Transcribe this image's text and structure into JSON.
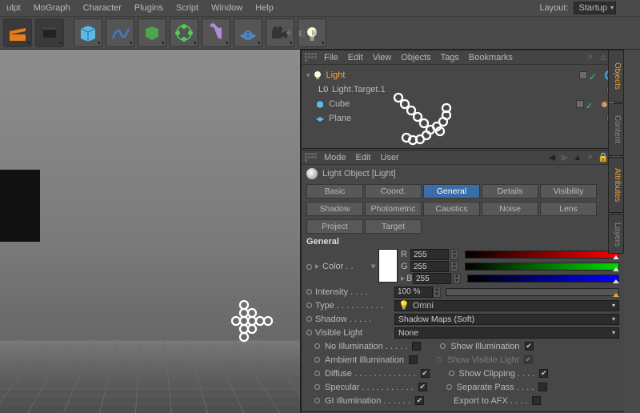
{
  "menu": {
    "items": [
      "ulpt",
      "MoGraph",
      "Character",
      "Plugins",
      "Script",
      "Window",
      "Help"
    ]
  },
  "layout": {
    "label": "Layout:",
    "value": "Startup"
  },
  "objects_panel": {
    "menus": [
      "File",
      "Edit",
      "View",
      "Objects",
      "Tags",
      "Bookmarks"
    ],
    "items": [
      {
        "name": "Light",
        "type": "light",
        "selected": true,
        "tag": "target"
      },
      {
        "name": "Light.Target.1",
        "type": "null",
        "indent": true
      },
      {
        "name": "Cube",
        "type": "cube",
        "active": true
      },
      {
        "name": "Plane",
        "type": "plane"
      }
    ]
  },
  "attributes_panel": {
    "menus": [
      "Mode",
      "Edit",
      "User"
    ],
    "title": "Light Object [Light]",
    "tabs_row1": [
      "Basic",
      "Coord.",
      "General",
      "Details",
      "Visibility"
    ],
    "tabs_row2": [
      "Shadow",
      "Photometric",
      "Caustics",
      "Noise",
      "Lens"
    ],
    "tabs_row3": [
      "Project",
      "Target"
    ],
    "active_tab": "General",
    "section": "General",
    "color": {
      "label": "Color . .",
      "r": "255",
      "g": "255",
      "b": "255",
      "labels": {
        "r": "R",
        "g": "G",
        "b": "B"
      }
    },
    "intensity": {
      "label": "Intensity . . . .",
      "value": "100 %"
    },
    "type": {
      "label": "Type . . . . . . . . . .",
      "value": "Omni"
    },
    "shadow": {
      "label": "Shadow . . . . .",
      "value": "Shadow Maps (Soft)"
    },
    "visible_light": {
      "label": "Visible Light",
      "value": "None"
    },
    "checks": {
      "no_illum": {
        "label": "No Illumination . . . . .",
        "value": false
      },
      "show_illum": {
        "label": "Show Illumination",
        "value": true
      },
      "ambient": {
        "label": "Ambient Illumination",
        "value": false
      },
      "show_vis": {
        "label": "Show Visible Light",
        "value": true,
        "disabled": true
      },
      "diffuse": {
        "label": "Diffuse . . . . . . . . . . . . .",
        "value": true
      },
      "show_clip": {
        "label": "Show Clipping . . . .",
        "value": true
      },
      "specular": {
        "label": "Specular . . . . . . . . . . .",
        "value": true
      },
      "separate": {
        "label": "Separate Pass . . . .",
        "value": false
      },
      "gi": {
        "label": "GI Illumination . . . . . .",
        "value": true
      },
      "afx": {
        "label": "Export to AFX . . . .",
        "value": false
      }
    }
  },
  "side_tabs": [
    "Objects",
    "Content",
    "Attributes",
    "Layers"
  ]
}
